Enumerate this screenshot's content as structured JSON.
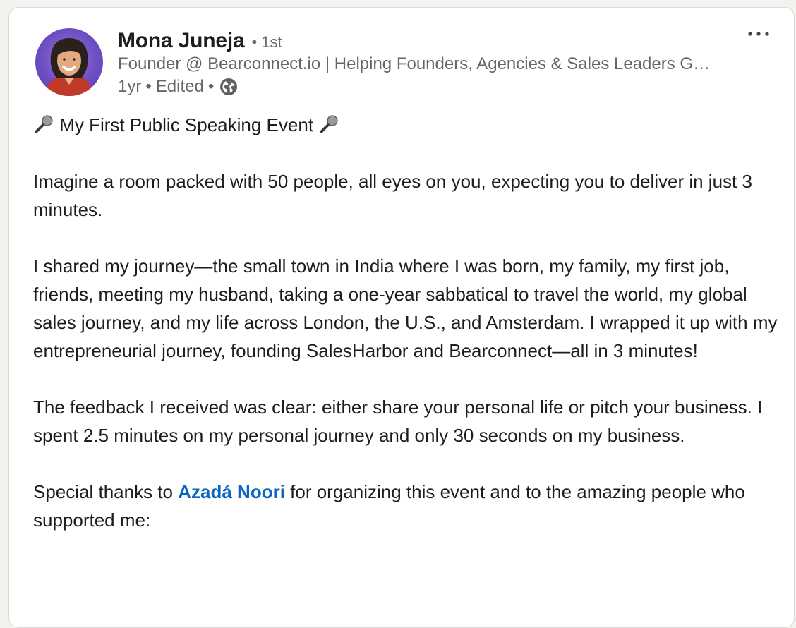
{
  "post": {
    "author": {
      "name": "Mona Juneja",
      "degree": "• 1st",
      "headline": "Founder @ Bearconnect.io | Helping Founders, Agencies & Sales Leaders Grow Pipeline on LinkedIn",
      "time": "1yr",
      "edited": "Edited",
      "visibility_icon": "globe-icon"
    },
    "more_icon": "more-options-icon",
    "title": {
      "icon": "microphone-icon",
      "text": "My First Public Speaking Event"
    },
    "paragraphs": {
      "p1": "Imagine a room packed with 50 people, all eyes on you, expecting you to deliver in just 3 minutes.",
      "p2": "I shared my journey—the small town in India where I was born, my family, my first job, friends, meeting my husband, taking a one-year sabbatical to travel the world, my global sales journey, and my life across London, the U.S., and Amsterdam. I wrapped it up with my entrepreneurial journey, founding SalesHarbor and Bearconnect—all in 3 minutes!",
      "p3": "The feedback I received was clear: either share your personal life or pitch your business. I spent 2.5 minutes on my personal journey and only 30 seconds on my business.",
      "p4_before": "Special thanks to ",
      "p4_mention": "Azadá Noori",
      "p4_after": " for organizing this event and to the amazing people who supported me:"
    },
    "colors": {
      "link": "#0a66c2",
      "text": "#1d1d1d",
      "muted": "#666666"
    }
  }
}
